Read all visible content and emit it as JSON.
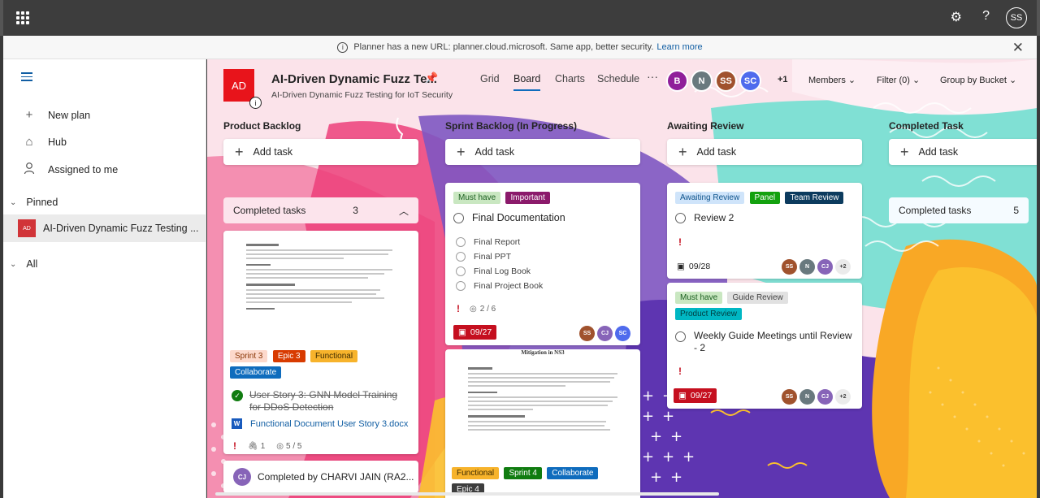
{
  "topbar": {
    "settings_icon": "gear-icon",
    "help_label": "?",
    "user_initials": "SS"
  },
  "banner": {
    "message": "Planner has a new URL: planner.cloud.microsoft. Same app, better security.",
    "link": "Learn more"
  },
  "sidebar": {
    "new_plan": "New plan",
    "hub": "Hub",
    "assigned": "Assigned to me",
    "pinned_label": "Pinned",
    "pinned_plan": {
      "badge": "AD",
      "name": "AI-Driven Dynamic Fuzz Testing ..."
    },
    "all_label": "All"
  },
  "plan": {
    "logo": "AD",
    "title": "AI-Driven Dynamic Fuzz Te...",
    "subtitle": "AI-Driven Dynamic Fuzz Testing for IoT Security",
    "views": [
      "Grid",
      "Board",
      "Charts",
      "Schedule"
    ],
    "more": "···",
    "members": [
      {
        "initials": "B",
        "color": "#8f1f9a"
      },
      {
        "initials": "N",
        "color": "#69797e"
      },
      {
        "initials": "SS",
        "color": "#a0522d"
      },
      {
        "initials": "SC",
        "color": "#4f6bed"
      }
    ],
    "extra_members": "+1",
    "members_btn": "Members",
    "filter_btn": "Filter (0)",
    "group_btn": "Group by Bucket"
  },
  "buckets": [
    {
      "title": "Product Backlog",
      "add_task": "Add task",
      "completed": {
        "label": "Completed tasks",
        "count": "3"
      },
      "card": {
        "labels": [
          {
            "text": "Sprint 3",
            "bg": "#fcd9cc",
            "fg": "#8a3707"
          },
          {
            "text": "Epic 3",
            "bg": "#d83b01",
            "fg": "#ffffff"
          },
          {
            "text": "Functional",
            "bg": "#f7b32b",
            "fg": "#3d2b00"
          },
          {
            "text": "Collaborate",
            "bg": "#0f6cbd",
            "fg": "#ffffff"
          }
        ],
        "title": "User Story 3: GNN Model Training for DDoS Detection",
        "attachment": "Functional Document User Story 3.docx",
        "attach_count": "1",
        "checklist": "5 / 5",
        "completed_by": "Completed by CHARVI JAIN (RA2...",
        "completed_by_initials": "CJ"
      }
    },
    {
      "title": "Sprint Backlog (In Progress)",
      "add_task": "Add task",
      "card": {
        "labels": [
          {
            "text": "Must have",
            "bg": "#c9e7c1",
            "fg": "#1b5e20"
          },
          {
            "text": "Important",
            "bg": "#8b1a6b",
            "fg": "#ffffff"
          }
        ],
        "title": "Final Documentation",
        "checklist": [
          "Final Report",
          "Final PPT",
          "Final Log Book",
          "Final Project Book"
        ],
        "checklist_count": "2 / 6",
        "due": "09/27",
        "assignees": [
          {
            "initials": "SS",
            "color": "#a0522d"
          },
          {
            "initials": "CJ",
            "color": "#8764b8"
          },
          {
            "initials": "SC",
            "color": "#4f6bed"
          }
        ]
      },
      "card2": {
        "doc_heading": "Mitigation in NS3",
        "labels": [
          {
            "text": "Functional",
            "bg": "#f7b32b",
            "fg": "#3d2b00"
          },
          {
            "text": "Sprint 4",
            "bg": "#107c10",
            "fg": "#ffffff"
          },
          {
            "text": "Collaborate",
            "bg": "#0f6cbd",
            "fg": "#ffffff"
          },
          {
            "text": "Epic 4",
            "bg": "#3d3d3d",
            "fg": "#ffffff"
          }
        ]
      }
    },
    {
      "title": "Awaiting Review",
      "add_task": "Add task",
      "card": {
        "labels": [
          {
            "text": "Awaiting Review",
            "bg": "#cfe4fa",
            "fg": "#0f548c"
          },
          {
            "text": "Panel",
            "bg": "#13a10e",
            "fg": "#ffffff"
          },
          {
            "text": "Team Review",
            "bg": "#0c3b5e",
            "fg": "#ffffff"
          }
        ],
        "title": "Review 2",
        "due": "09/28",
        "assignees": [
          {
            "initials": "SS",
            "color": "#a0522d"
          },
          {
            "initials": "N",
            "color": "#69797e"
          },
          {
            "initials": "CJ",
            "color": "#8764b8"
          }
        ],
        "more": "+2"
      },
      "card2": {
        "labels": [
          {
            "text": "Must have",
            "bg": "#c9e7c1",
            "fg": "#1b5e20"
          },
          {
            "text": "Guide Review",
            "bg": "#e1e1e1",
            "fg": "#424242"
          },
          {
            "text": "Product Review",
            "bg": "#00b7c3",
            "fg": "#003d40"
          }
        ],
        "title": "Weekly Guide Meetings until Review - 2",
        "due": "09/27",
        "assignees": [
          {
            "initials": "SS",
            "color": "#a0522d"
          },
          {
            "initials": "N",
            "color": "#69797e"
          },
          {
            "initials": "CJ",
            "color": "#8764b8"
          }
        ],
        "more": "+2"
      }
    },
    {
      "title": "Completed Task",
      "add_task": "Add task",
      "completed": {
        "label": "Completed tasks",
        "count": "5"
      }
    }
  ]
}
